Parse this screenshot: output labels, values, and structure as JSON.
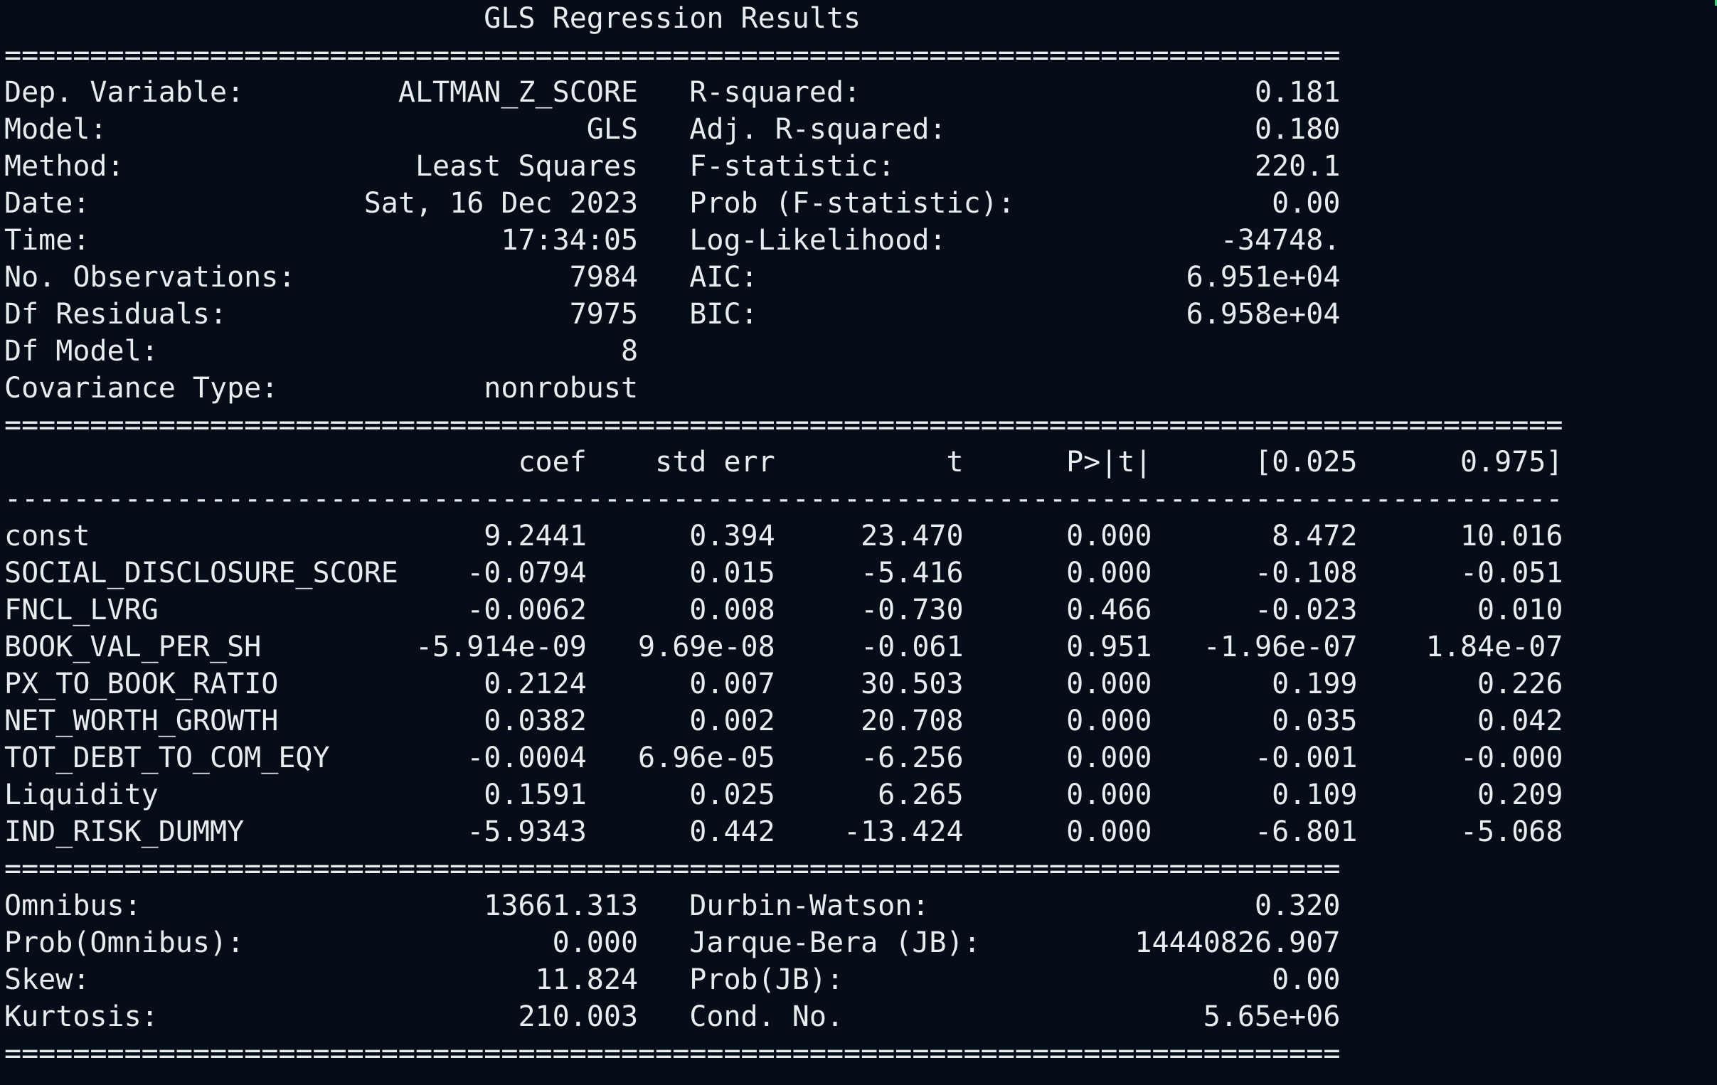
{
  "terminal": {
    "background": "#040d18",
    "foreground": "#e8ecef",
    "accent": "#3cd27a"
  },
  "summary": {
    "title": "GLS Regression Results",
    "top_rule": "==============================================================================",
    "model_info": [
      {
        "left_label": "Dep. Variable:",
        "left_value": "ALTMAN_Z_SCORE",
        "right_label": "R-squared:",
        "right_value": "0.181"
      },
      {
        "left_label": "Model:",
        "left_value": "GLS",
        "right_label": "Adj. R-squared:",
        "right_value": "0.180"
      },
      {
        "left_label": "Method:",
        "left_value": "Least Squares",
        "right_label": "F-statistic:",
        "right_value": "220.1"
      },
      {
        "left_label": "Date:",
        "left_value": "Sat, 16 Dec 2023",
        "right_label": "Prob (F-statistic):",
        "right_value": "0.00"
      },
      {
        "left_label": "Time:",
        "left_value": "17:34:05",
        "right_label": "Log-Likelihood:",
        "right_value": "-34748."
      },
      {
        "left_label": "No. Observations:",
        "left_value": "7984",
        "right_label": "AIC:",
        "right_value": "6.951e+04"
      },
      {
        "left_label": "Df Residuals:",
        "left_value": "7975",
        "right_label": "BIC:",
        "right_value": "6.958e+04"
      },
      {
        "left_label": "Df Model:",
        "left_value": "8",
        "right_label": "",
        "right_value": ""
      },
      {
        "left_label": "Covariance Type:",
        "left_value": "nonrobust",
        "right_label": "",
        "right_value": ""
      }
    ],
    "coef_top_rule": "===========================================================================================",
    "coef_header": [
      "coef",
      "std err",
      "t",
      "P>|t|",
      "[0.025",
      "0.975]"
    ],
    "coef_mid_rule": "-------------------------------------------------------------------------------------------",
    "coefficients": [
      {
        "name": "const",
        "coef": "9.2441",
        "std_err": "0.394",
        "t": "23.470",
        "p": "0.000",
        "lo": "8.472",
        "hi": "10.016"
      },
      {
        "name": "SOCIAL_DISCLOSURE_SCORE",
        "coef": "-0.0794",
        "std_err": "0.015",
        "t": "-5.416",
        "p": "0.000",
        "lo": "-0.108",
        "hi": "-0.051"
      },
      {
        "name": "FNCL_LVRG",
        "coef": "-0.0062",
        "std_err": "0.008",
        "t": "-0.730",
        "p": "0.466",
        "lo": "-0.023",
        "hi": "0.010"
      },
      {
        "name": "BOOK_VAL_PER_SH",
        "coef": "-5.914e-09",
        "std_err": "9.69e-08",
        "t": "-0.061",
        "p": "0.951",
        "lo": "-1.96e-07",
        "hi": "1.84e-07"
      },
      {
        "name": "PX_TO_BOOK_RATIO",
        "coef": "0.2124",
        "std_err": "0.007",
        "t": "30.503",
        "p": "0.000",
        "lo": "0.199",
        "hi": "0.226"
      },
      {
        "name": "NET_WORTH_GROWTH",
        "coef": "0.0382",
        "std_err": "0.002",
        "t": "20.708",
        "p": "0.000",
        "lo": "0.035",
        "hi": "0.042"
      },
      {
        "name": "TOT_DEBT_TO_COM_EQY",
        "coef": "-0.0004",
        "std_err": "6.96e-05",
        "t": "-6.256",
        "p": "0.000",
        "lo": "-0.001",
        "hi": "-0.000"
      },
      {
        "name": "Liquidity",
        "coef": "0.1591",
        "std_err": "0.025",
        "t": "6.265",
        "p": "0.000",
        "lo": "0.109",
        "hi": "0.209"
      },
      {
        "name": "IND_RISK_DUMMY",
        "coef": "-5.9343",
        "std_err": "0.442",
        "t": "-13.424",
        "p": "0.000",
        "lo": "-6.801",
        "hi": "-5.068"
      }
    ],
    "diag_top_rule": "==============================================================================",
    "diagnostics": [
      {
        "left_label": "Omnibus:",
        "left_value": "13661.313",
        "right_label": "Durbin-Watson:",
        "right_value": "0.320"
      },
      {
        "left_label": "Prob(Omnibus):",
        "left_value": "0.000",
        "right_label": "Jarque-Bera (JB):",
        "right_value": "14440826.907"
      },
      {
        "left_label": "Skew:",
        "left_value": "11.824",
        "right_label": "Prob(JB):",
        "right_value": "0.00"
      },
      {
        "left_label": "Kurtosis:",
        "left_value": "210.003",
        "right_label": "Cond. No.",
        "right_value": "5.65e+06"
      }
    ],
    "bottom_rule": "=============================================================================="
  }
}
